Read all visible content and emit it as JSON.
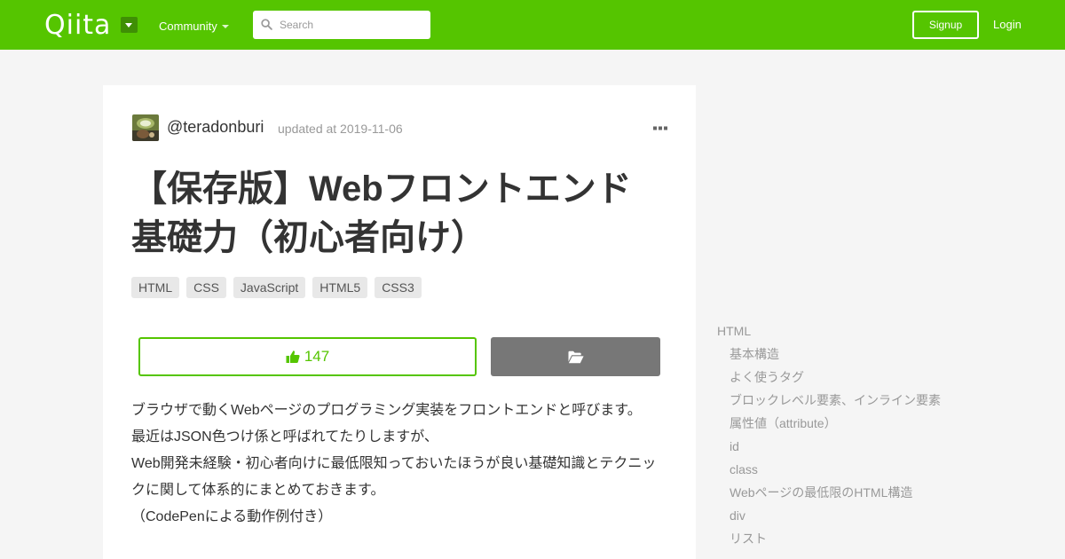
{
  "header": {
    "logo": "Qiita",
    "community_label": "Community",
    "search_placeholder": "Search",
    "signup_label": "Signup",
    "login_label": "Login"
  },
  "article": {
    "author": "@teradonburi",
    "updated": "updated at 2019-11-06",
    "title_line1": "【保存版】Webフロントエンド",
    "title_line2": "基礎力（初心者向け）",
    "tags": [
      "HTML",
      "CSS",
      "JavaScript",
      "HTML5",
      "CSS3"
    ],
    "like_count": "147",
    "body": [
      "ブラウザで動くWebページのプログラミング実装をフロントエンドと呼びます。",
      "最近はJSON色つけ係と呼ばれてたりしますが、",
      "Web開発未経験・初心者向けに最低限知っておいたほうが良い基礎知識とテクニッ",
      "クに関して体系的にまとめておきます。",
      "（CodePenによる動作例付き）"
    ]
  },
  "toc": {
    "top": "HTML",
    "items": [
      "基本構造",
      "よく使うタグ",
      "ブロックレベル要素、インライン要素",
      "属性値（attribute）",
      "id",
      "class",
      "Webページの最低限のHTML構造",
      "div",
      "リスト"
    ]
  },
  "colors": {
    "brand": "#55c500",
    "stock_button": "#777777",
    "tag_bg": "#e8e8e8"
  },
  "icons": {
    "search": "search-icon",
    "like": "thumbs-up-icon",
    "stock": "folder-open-icon",
    "more": "ellipsis-icon"
  }
}
